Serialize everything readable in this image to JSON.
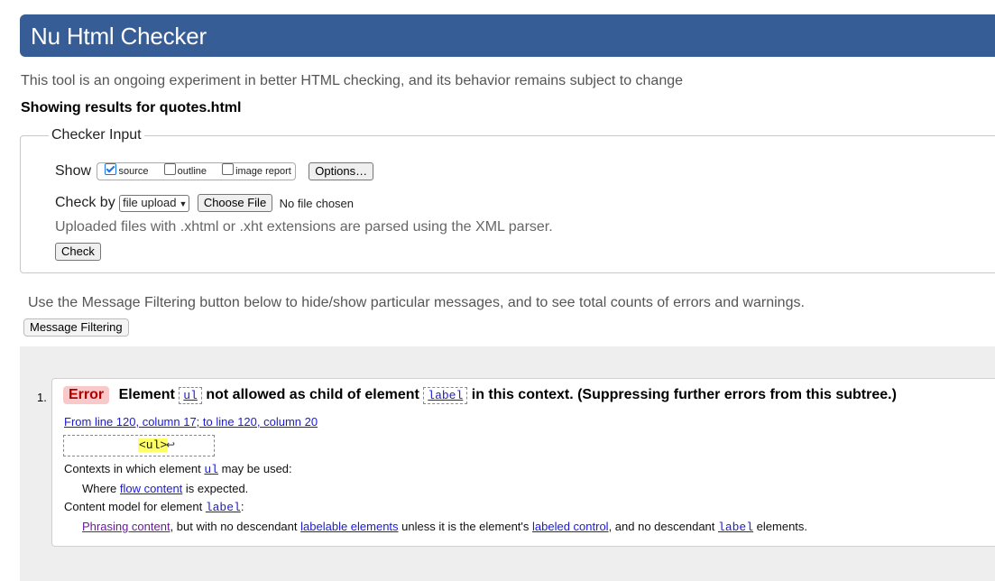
{
  "header": {
    "title": "Nu Html Checker"
  },
  "intro": "This tool is an ongoing experiment in better HTML checking, and its behavior remains subject to change",
  "results_for": "Showing results for quotes.html",
  "checker_input": {
    "legend": "Checker Input",
    "show_label": "Show",
    "show_options": [
      {
        "label": "source",
        "checked": true
      },
      {
        "label": "outline",
        "checked": false
      },
      {
        "label": "image report",
        "checked": false
      }
    ],
    "options_button": "Options…",
    "check_by_label": "Check by",
    "check_by_value": "file upload",
    "choose_file_button": "Choose File",
    "no_file_text": "No file chosen",
    "xml_note": "Uploaded files with .xhtml or .xht extensions are parsed using the XML parser.",
    "check_button": "Check"
  },
  "filter_note": "Use the Message Filtering button below to hide/show particular messages, and to see total counts of errors and warnings.",
  "filter_button": "Message Filtering",
  "messages": [
    {
      "number": "1.",
      "type": "Error",
      "text_element": "Element",
      "element": "ul",
      "text_not_allowed": "not allowed as child of element",
      "parent": "label",
      "text_context": "in this context. (Suppressing further errors from this subtree.)",
      "location": "From line 120, column 17; to line 120, column 20",
      "extract": "<ul>",
      "extract_lf": "↩",
      "contexts_prefix": "Contexts in which element",
      "contexts_element": "ul",
      "contexts_suffix": "may be used:",
      "where_prefix": "Where",
      "where_link": "flow content",
      "where_suffix": "is expected.",
      "model_prefix": "Content model for element",
      "model_element": "label",
      "model_suffix": ":",
      "phrasing_link": "Phrasing content",
      "phrasing_mid": ", but with no descendant",
      "labelable_link": "labelable elements",
      "unless_text": "unless it is the element's",
      "labeled_link": "labeled control",
      "and_text": ", and no descendant",
      "label_code": "label",
      "elements_text": "elements."
    }
  ]
}
